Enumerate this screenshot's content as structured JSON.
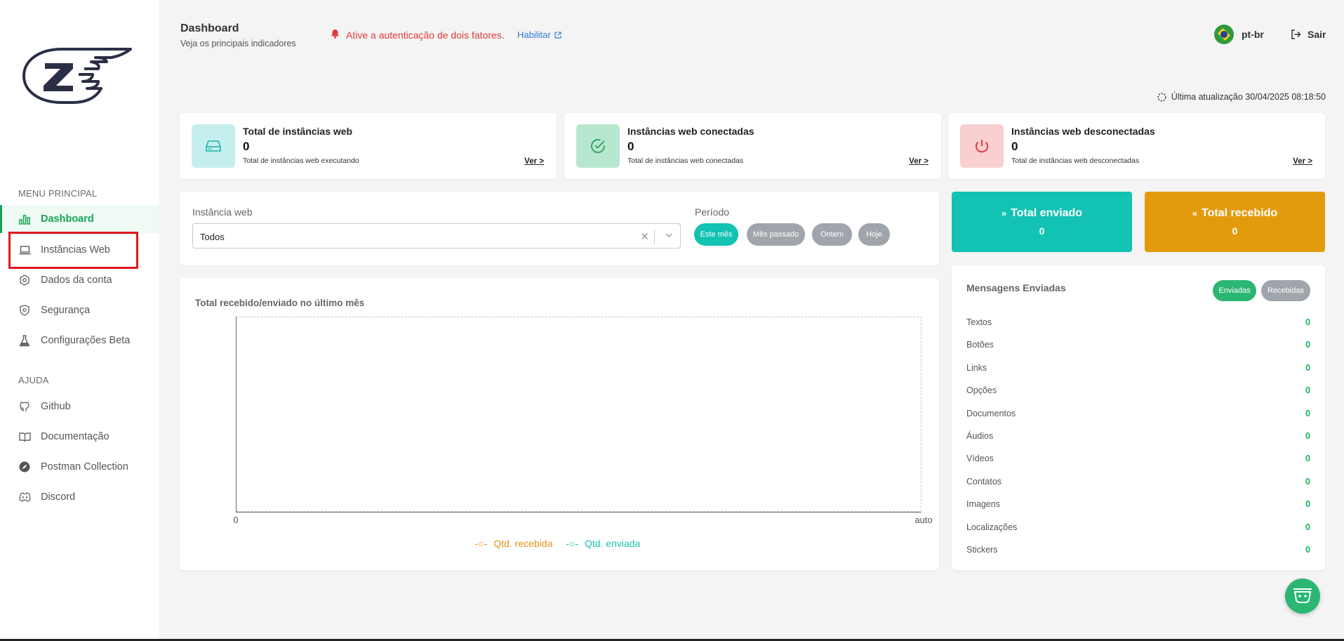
{
  "header": {
    "title": "Dashboard",
    "subtitle": "Veja os principais indicadores",
    "alert_text": "Ative a autenticação de dois fatores.",
    "alert_link": "Habilitar",
    "language": "pt-br",
    "logout": "Sair",
    "last_update": "Última atualização 30/04/2025 08:18:50"
  },
  "sidebar": {
    "section_main": "MENU PRINCIPAL",
    "section_help": "AJUDA",
    "items": [
      {
        "label": "Dashboard",
        "icon": "chart-bar-icon",
        "active": true
      },
      {
        "label": "Instâncias Web",
        "icon": "laptop-icon"
      },
      {
        "label": "Dados da conta",
        "icon": "gear-icon"
      },
      {
        "label": "Segurança",
        "icon": "shield-icon"
      },
      {
        "label": "Configurações Beta",
        "icon": "flask-icon"
      }
    ],
    "help_items": [
      {
        "label": "Github",
        "icon": "github-icon"
      },
      {
        "label": "Documentação",
        "icon": "book-icon"
      },
      {
        "label": "Postman Collection",
        "icon": "compass-icon"
      },
      {
        "label": "Discord",
        "icon": "discord-icon"
      }
    ]
  },
  "stats": [
    {
      "title": "Total de instâncias web",
      "value": "0",
      "desc": "Total de instâncias web executando",
      "link": "Ver >",
      "icon": "hard-drive-icon",
      "color": "#c5efee"
    },
    {
      "title": "Instâncias web conectadas",
      "value": "0",
      "desc": "Total de instâncias web conectadas",
      "link": "Ver >",
      "icon": "check-circle-icon",
      "color": "#b8e7cf"
    },
    {
      "title": "Instâncias web desconectadas",
      "value": "0",
      "desc": "Total de instâncias web desconectadas",
      "link": "Ver >",
      "icon": "power-icon",
      "color": "#f9cfcf"
    }
  ],
  "filters": {
    "instance_label": "Instância web",
    "instance_value": "Todos",
    "period_label": "Período",
    "periods": [
      "Este mês",
      "Mês passado",
      "Ontem",
      "Hoje"
    ]
  },
  "totals": {
    "sent_label": "Total enviado",
    "sent_value": "0",
    "received_label": "Total recebido",
    "received_value": "0"
  },
  "chart_data": {
    "type": "line",
    "title": "Total recebido/enviado no último mês",
    "x_tick_labels": [
      "0",
      "auto"
    ],
    "series": [
      {
        "name": "Qtd. recebida",
        "values": [],
        "color": "#e8911a"
      },
      {
        "name": "Qtd. enviada",
        "values": [],
        "color": "#1fbfb0"
      }
    ]
  },
  "messages": {
    "title": "Mensagens Enviadas",
    "tab_sent": "Enviadas",
    "tab_received": "Recebidas",
    "rows": [
      {
        "label": "Textos",
        "value": "0"
      },
      {
        "label": "Botões",
        "value": "0"
      },
      {
        "label": "Links",
        "value": "0"
      },
      {
        "label": "Opções",
        "value": "0"
      },
      {
        "label": "Documentos",
        "value": "0"
      },
      {
        "label": "Áudios",
        "value": "0"
      },
      {
        "label": "Vídeos",
        "value": "0"
      },
      {
        "label": "Contatos",
        "value": "0"
      },
      {
        "label": "Imagens",
        "value": "0"
      },
      {
        "label": "Localizações",
        "value": "0"
      },
      {
        "label": "Stickers",
        "value": "0"
      }
    ]
  }
}
